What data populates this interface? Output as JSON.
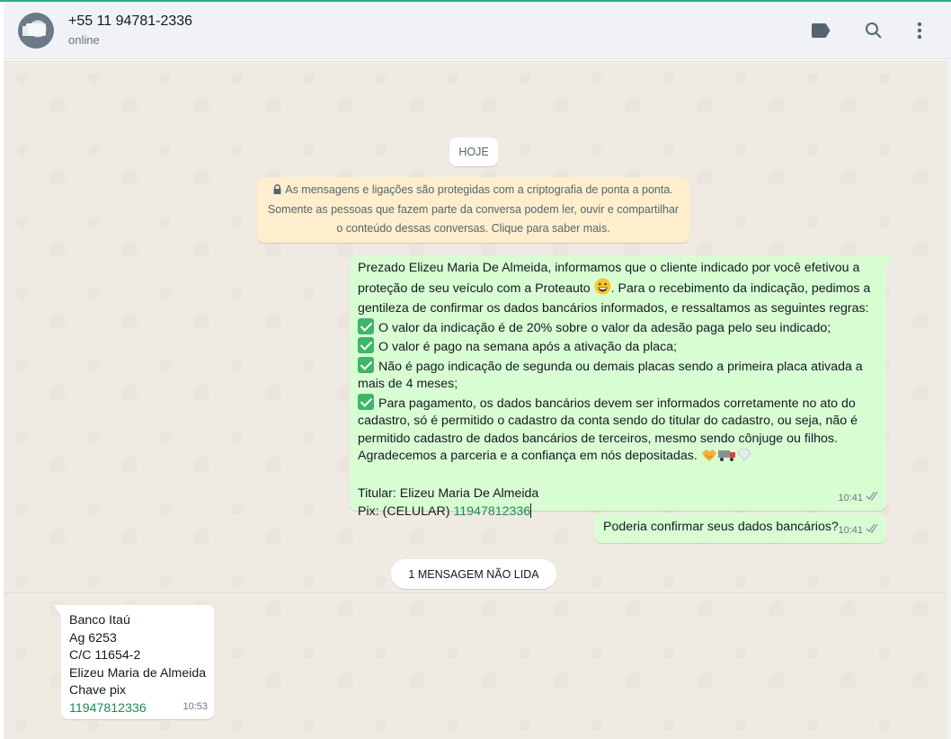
{
  "header": {
    "contact_name": "+55 11 94781-2336",
    "status": "online",
    "icons": [
      "label-icon",
      "search-icon",
      "menu-icon"
    ]
  },
  "chat": {
    "date_label": "HOJE",
    "encryption_notice": {
      "line1": "As mensagens e ligações são protegidas com a criptografia de ponta a ponta.",
      "line2": "Somente as pessoas que fazem parte da conversa podem ler, ouvir e compartilhar",
      "line3": "o conteúdo dessas conversas. Clique para saber mais."
    },
    "message1": {
      "l1": "Prezado Elizeu Maria De Almeida, informamos que o cliente indicado por você efetivou a",
      "l2a": "proteção de seu veículo com a Proteauto ",
      "l2b": ". Para o recebimento da indicação, pedimos a",
      "l3": "gentileza de confirmar os dados bancários informados, e  ressaltamos as seguintes regras:",
      "l4": "O valor da indicação é de 20% sobre o valor da adesão paga pelo seu indicado;",
      "l5": "O valor é pago na semana após a ativação da placa;",
      "l6": "Não é pago indicação de segunda ou demais placas sendo a primeira placa ativada a",
      "l7": "mais de 4 meses;",
      "l8": "Para pagamento, os dados bancários devem ser informados corretamente no ato do",
      "l9": "cadastro, só é permitido o cadastro da conta sendo do titular do cadastro, ou seja, não é",
      "l10": "permitido cadastro de dados bancários de terceiros, mesmo sendo cônjuge ou filhos.",
      "l11": "Agradecemos a parceria e a confiança em nós depositadas. ",
      "titular": "Titular: Elizeu Maria De Almeida",
      "pix_label": "Pix: (CELULAR) ",
      "pix_number": "11947812336",
      "time": "10:41"
    },
    "message2": {
      "text": "Poderia confirmar seus dados bancários?",
      "time": "10:41"
    },
    "unread_label": "1 MENSAGEM NÃO LIDA",
    "message3": {
      "l1": "Banco Itaú",
      "l2": "Ag 6253",
      "l3": "C/C 11654-2",
      "l4": "Elizeu Maria de Almeida",
      "l5": "Chave pix",
      "l6": "11947812336",
      "time": "10:53"
    }
  },
  "colors": {
    "accent": "#25b083",
    "outgoing_bubble": "#d9fdd3",
    "incoming_bubble": "#ffffff",
    "chat_background": "#efeae2",
    "notice_background": "#ffeecd"
  }
}
